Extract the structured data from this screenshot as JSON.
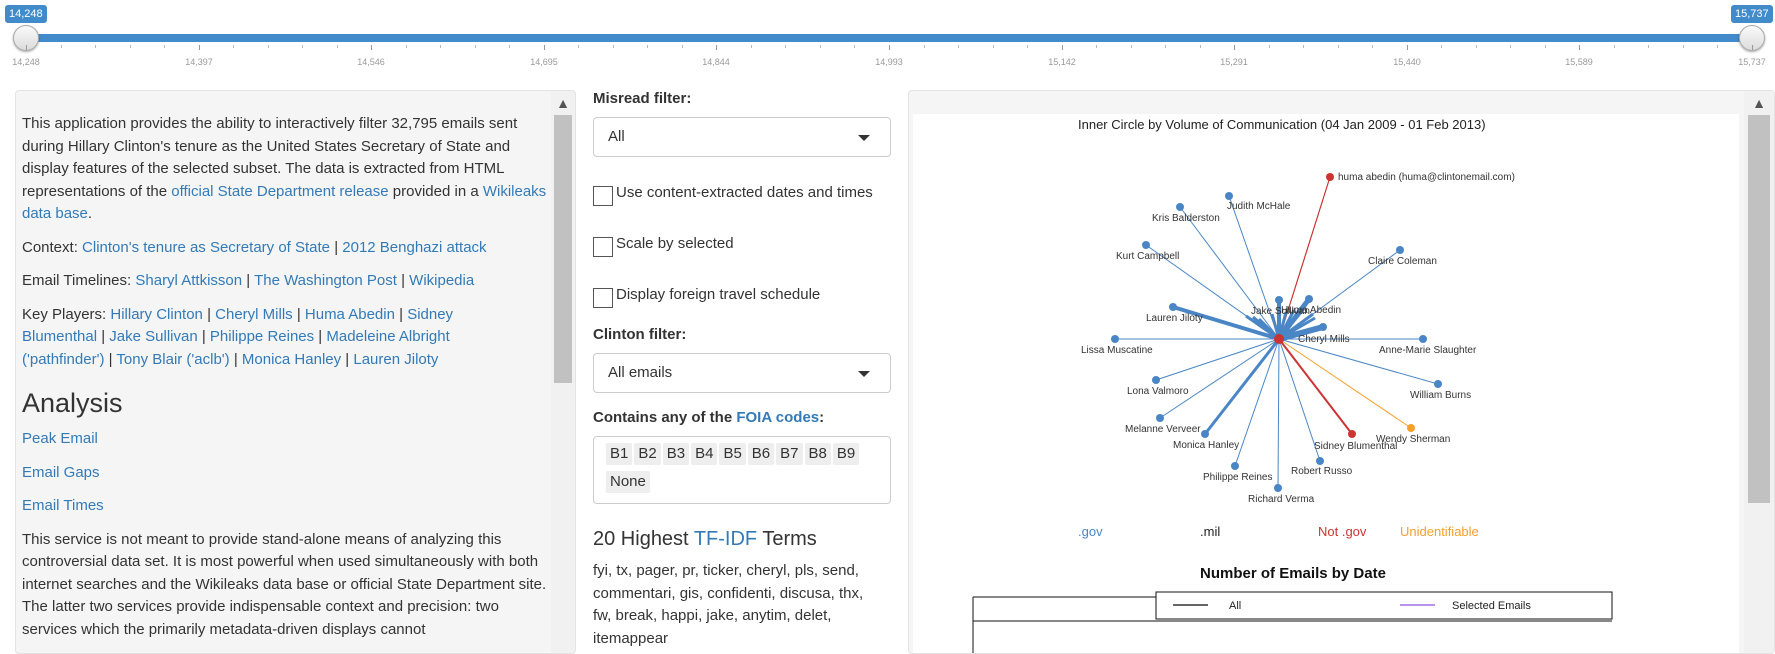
{
  "slider": {
    "from_label": "14,248",
    "to_label": "15,737",
    "min": 14248,
    "max": 15737,
    "from": 14248,
    "to": 15737,
    "tick_labels": [
      "14,248",
      "14,397",
      "14,546",
      "14,695",
      "14,844",
      "14,993",
      "15,142",
      "15,291",
      "15,440",
      "15,589",
      "15,737"
    ]
  },
  "left": {
    "intro": {
      "t1": "This application provides the ability to interactively filter 32,795 emails sent during Hillary Clinton's tenure as the United States Secretary of State and display features of the selected subset. The data is extracted from HTML representations of the ",
      "link1": "official State Department release",
      "t2": " provided in a ",
      "link2": "Wikileaks data base",
      "t3": "."
    },
    "context": {
      "label": "Context: ",
      "link1": "Clinton's tenure as Secretary of State",
      "sep": " | ",
      "link2": "2012 Benghazi attack"
    },
    "timelines": {
      "label": "Email Timelines: ",
      "links": [
        "Sharyl Attkisson",
        "The Washington Post",
        "Wikipedia"
      ],
      "sep": " | "
    },
    "players": {
      "label": "Key Players: ",
      "links": [
        "Hillary Clinton",
        "Cheryl Mills",
        "Huma Abedin",
        "Sidney Blumenthal",
        "Jake Sullivan",
        "Philippe Reines",
        "Madeleine Albright ('pathfinder')",
        "Tony Blair ('aclb')",
        "Monica Hanley",
        "Lauren Jiloty"
      ],
      "sep": " | "
    },
    "analysis_heading": "Analysis",
    "analysis_links": [
      "Peak Email",
      "Email Gaps",
      "Email Times"
    ],
    "service_text": "This service is not meant to provide stand-alone means of analyzing this controversial data set. It is most powerful when used simultaneously with both internet searches and the Wikileaks data base or official State Department site. The latter two services provide indispensable context and precision: two services which the primarily metadata-driven displays cannot"
  },
  "middle": {
    "misread_label": "Misread filter:",
    "misread_value": "All",
    "checkbox1": "Use content-extracted dates and times",
    "checkbox2": "Scale by selected",
    "checkbox3": "Display foreign travel schedule",
    "clinton_label": "Clinton filter:",
    "clinton_value": "All emails",
    "foia_prefix": "Contains any of the ",
    "foia_link": "FOIA codes",
    "foia_suffix": ":",
    "codes": [
      "B1",
      "B2",
      "B3",
      "B4",
      "B5",
      "B6",
      "B7",
      "B8",
      "B9",
      "None"
    ],
    "terms_heading_prefix": "20 Highest ",
    "terms_heading_link": "TF-IDF",
    "terms_heading_suffix": " Terms",
    "terms": "fyi, tx, pager, pr, ticker, cheryl, pls, send, commentari, gis, confidenti, discusa, thx, fw, break, happi, jake, anytim, delet, itemappear"
  },
  "right": {
    "network": {
      "title_bold": "Inner Circle",
      "title_rest": " by Volume of Communication (04 Jan 2009 - 01 Feb 2013)",
      "nodes": [
        {
          "name": "huma abedin (huma@clintonemail.com)",
          "cat": "notgov"
        },
        {
          "name": "Judith McHale",
          "cat": "gov"
        },
        {
          "name": "Kris Balderston",
          "cat": "gov"
        },
        {
          "name": "Kurt Campbell",
          "cat": "gov"
        },
        {
          "name": "Claire Coleman",
          "cat": "gov"
        },
        {
          "name": "Lauren Jiloty",
          "cat": "gov"
        },
        {
          "name": "Jake Sullivan",
          "cat": "gov"
        },
        {
          "name": "Huma Abedin",
          "cat": "gov"
        },
        {
          "name": "Cheryl Mills",
          "cat": "gov"
        },
        {
          "name": "Lissa Muscatine",
          "cat": "gov"
        },
        {
          "name": "Anne-Marie Slaughter",
          "cat": "gov"
        },
        {
          "name": "Lona Valmoro",
          "cat": "gov"
        },
        {
          "name": "William Burns",
          "cat": "gov"
        },
        {
          "name": "Melanne Verveer",
          "cat": "gov"
        },
        {
          "name": "Monica Hanley",
          "cat": "gov"
        },
        {
          "name": "Sidney Blumenthal",
          "cat": "notgov"
        },
        {
          "name": "Wendy Sherman",
          "cat": "unid"
        },
        {
          "name": "Robert Russo",
          "cat": "gov"
        },
        {
          "name": "Philippe Reines",
          "cat": "gov"
        },
        {
          "name": "Richard Verma",
          "cat": "gov"
        }
      ],
      "legend": [
        {
          "label": ".gov",
          "color": "#4a86c5"
        },
        {
          "label": ".mil",
          "color": "#222222"
        },
        {
          "label": "Not .gov",
          "color": "#cc3333"
        },
        {
          "label": "Unidentifiable",
          "color": "#f5a02a"
        }
      ]
    },
    "bydate": {
      "title": "Number of Emails by Date",
      "legend": [
        {
          "label": "All",
          "color": "#333333"
        },
        {
          "label": "Selected Emails",
          "color": "#a070e0"
        }
      ]
    }
  },
  "colors": {
    "accent": "#428bca",
    "link": "#337ab7",
    "gov": "#4a86c5",
    "notgov": "#cc3333",
    "unid": "#f5a02a"
  }
}
